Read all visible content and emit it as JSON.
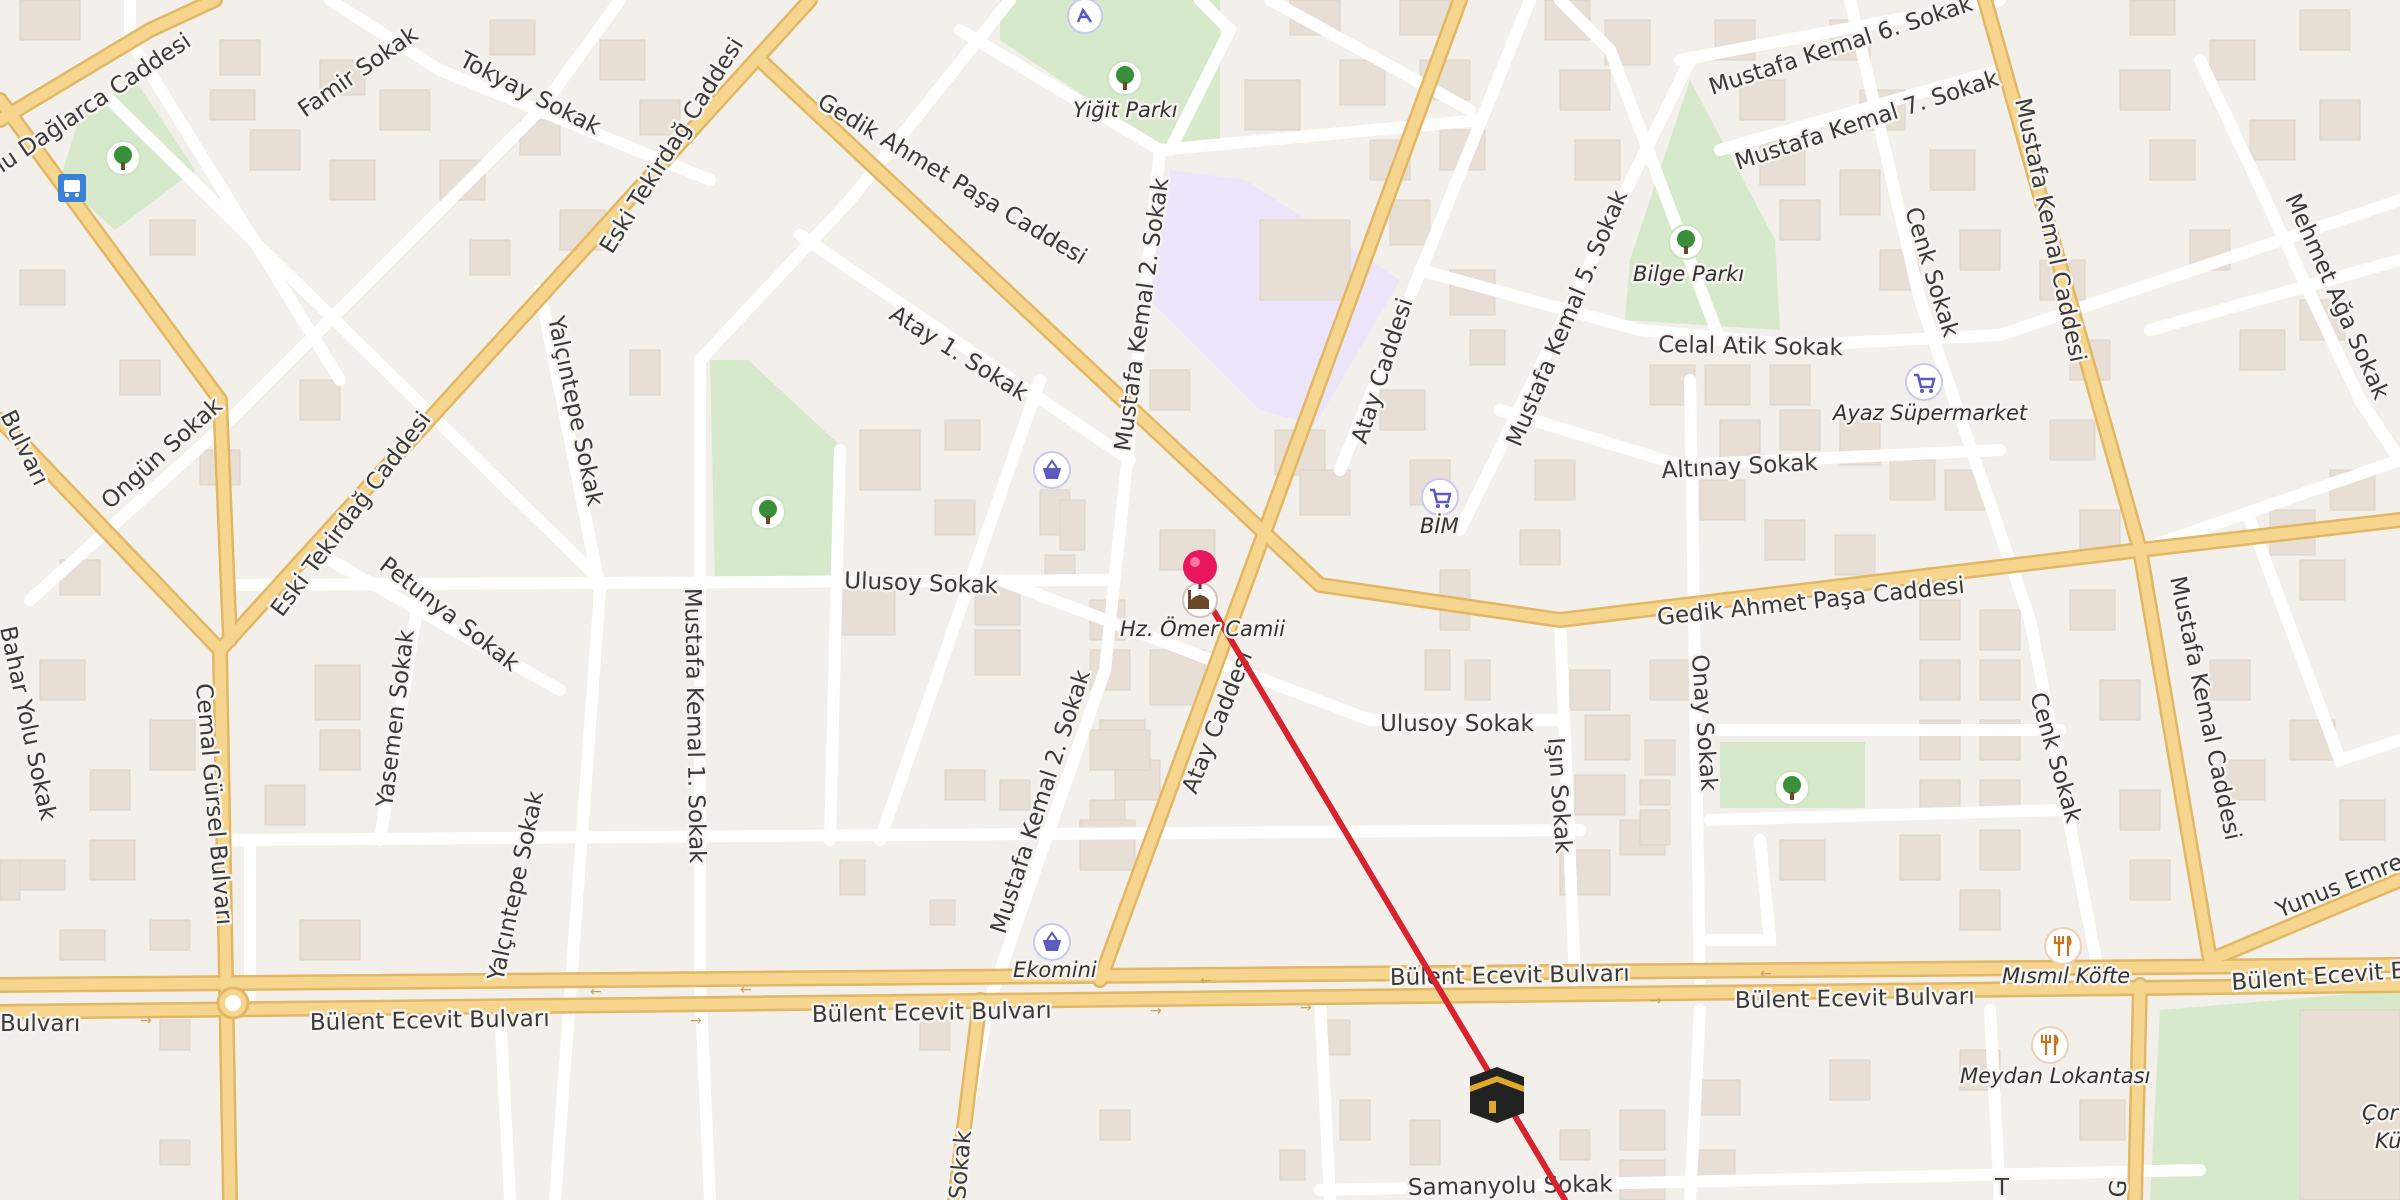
{
  "map": {
    "street_labels": {
      "cemal_gursel_bulvari": "Cemal Gürsel Bulvarı",
      "bulvari_left": "Bulvarı",
      "dagarca_caddesi": "nu Dağlarca Caddesi",
      "famir_sokak": "Famir Sokak",
      "tokyay_sokak": "Tokyay Sokak",
      "ongun_sokak": "Ongün Sokak",
      "bahar_yolu_sokak": "Bahar Yolu Sokak",
      "eski_tekirdag_caddesi_top": "Eski Tekirdağ Caddesi",
      "eski_tekirdag_caddesi_mid": "Eski Tekirdağ Caddesi",
      "petunya_sokak": "Petunya Sokak",
      "yasemen_sokak": "Yasemen Sokak",
      "yalcintepe_sokak_top": "Yalçıntepe Sokak",
      "yalcintepe_sokak_bottom": "Yalçıntepe Sokak",
      "mustafa_kemal_1_sokak": "Mustafa Kemal 1. Sokak",
      "gedik_ahmet_pasa_caddesi_top": "Gedik Ahmet Paşa Caddesi",
      "gedik_ahmet_pasa_caddesi_right": "Gedik Ahmet Paşa Caddesi",
      "atay_1_sokak": "Atay 1. Sokak",
      "ulusoy_sokak_left": "Ulusoy Sokak",
      "ulusoy_sokak_right": "Ulusoy Sokak",
      "mustafa_kemal_2_sokak_top": "Mustafa Kemal 2. Sokak",
      "mustafa_kemal_2_sokak_bottom": "Mustafa Kemal 2. Sokak",
      "atay_caddesi_top": "Atay Caddesi",
      "atay_caddesi_bottom": "Atay Caddesi",
      "mustafa_kemal_5_sokak": "Mustafa Kemal 5. Sokak",
      "mustafa_kemal_6_sokak": "Mustafa Kemal 6. Sokak",
      "mustafa_kemal_7_sokak": "Mustafa Kemal 7. Sokak",
      "celal_atik_sokak": "Celal Atik Sokak",
      "altinay_sokak": "Altınay Sokak",
      "cenk_sokak_top": "Cenk Sokak",
      "cenk_sokak_bottom": "Cenk Sokak",
      "isin_sokak": "Işın Sokak",
      "onay_sokak": "Onay Sokak",
      "mustafa_kemal_caddesi_top": "Mustafa Kemal Caddesi",
      "mustafa_kemal_caddesi_bottom": "Mustafa Kemal Caddesi",
      "mehmet_aga_sokak": "Mehmet Ağa Sokak",
      "yunus_emre": "Yunus Emre",
      "bulent_ecevit_bulvari_left": "Bülent Ecevit Bulvarı",
      "bulent_ecevit_bulvari_center": "Bülent Ecevit Bulvarı",
      "bulent_ecevit_bulvari_upper": "Bülent Ecevit Bulvarı",
      "bulent_ecevit_bulvari_right": "Bülent Ecevit Bulvarı",
      "bulent_ecevit_bulvari_far_right": "Bülent Ecevit B",
      "bulent_ecevit_bulvari_far_left": "Bulvarı",
      "samanyolu_sokak": "Samanyolu Sokak",
      "edge_sokak": "Sokak",
      "edge_t": "T",
      "edge_g": "G"
    },
    "poi_labels": {
      "yigit_parki": "Yiğit Parkı",
      "bilge_parki": "Bilge Parkı",
      "ayaz_supermarket": "Ayaz Süpermarket",
      "bim": "BİM",
      "ekomini": "Ekomini",
      "hz_omer_camii": "Hz. Ömer Camii",
      "mismil_kofte": "Mısmıl Köfte",
      "meydan_lokantasi": "Meydan Lokantası",
      "corner_right_1": "Çor",
      "corner_right_2": "Kü"
    },
    "icons": {
      "park": "tree-icon",
      "shop": "shopping-basket-icon",
      "supermarket": "shopping-cart-icon",
      "restaurant": "fork-knife-icon",
      "mosque": "mosque-icon",
      "bus": "bus-stop-icon",
      "kaaba": "kaaba-icon",
      "pin": "location-pin-icon",
      "playground": "playground-icon"
    },
    "colors": {
      "background": "#f3efeb",
      "building": "#e7dfd6",
      "park": "#d6e9cb",
      "school": "#ece5fb",
      "major_road": "#f6d68f",
      "major_road_casing": "#e2b763",
      "minor_road": "#ffffff",
      "qibla_line": "#d6232e",
      "pin": "#e8175d",
      "poi_shop": "#5b5bbf",
      "poi_park": "#3a8f3a",
      "poi_food": "#c8741f"
    }
  }
}
